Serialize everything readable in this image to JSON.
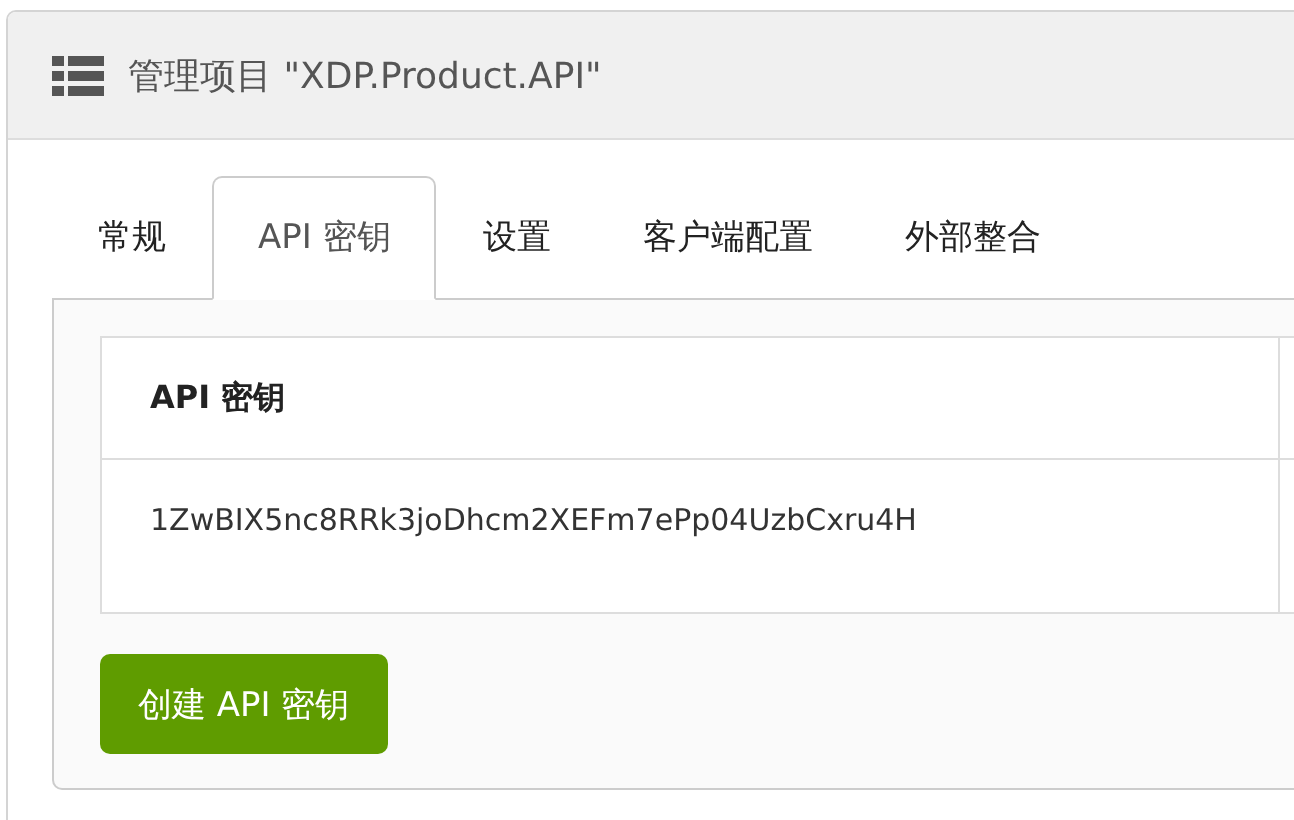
{
  "panel": {
    "title": "管理项目 \"XDP.Product.API\""
  },
  "tabs": [
    {
      "label": "常规",
      "selected": false
    },
    {
      "label": "API 密钥",
      "selected": true
    },
    {
      "label": "设置",
      "selected": false
    },
    {
      "label": "客户端配置",
      "selected": false
    },
    {
      "label": "外部整合",
      "selected": false
    }
  ],
  "table": {
    "columns": [
      "API 密钥"
    ],
    "rows": [
      [
        "1ZwBIX5nc8RRk3joDhcm2XEFm7ePp04UzbCxru4H"
      ]
    ]
  },
  "buttons": [
    {
      "label": "创建 API 密钥"
    }
  ]
}
